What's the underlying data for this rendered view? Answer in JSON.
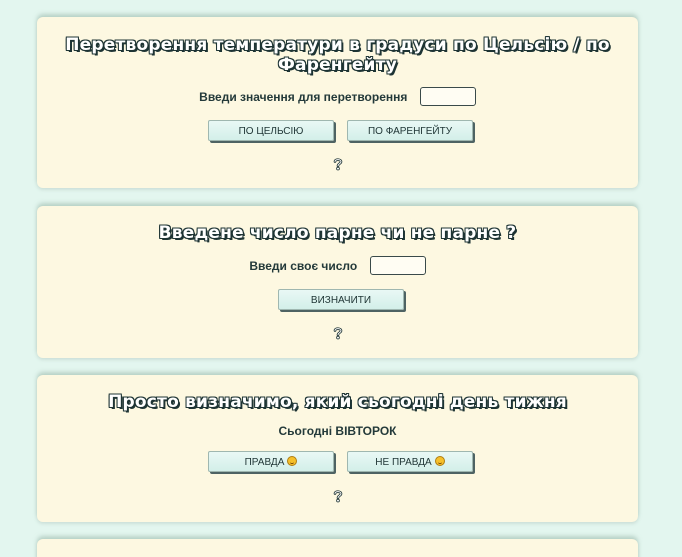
{
  "temperature": {
    "title_line1": "Перетворення температури в градуси по Цельсію / по",
    "title_line2": "Фаренгейту",
    "input_label": "Введи значення для перетворення",
    "input_value": "",
    "btn_celsius": "ПО ЦЕЛЬСІЮ",
    "btn_fahrenheit": "ПО ФАРЕНГЕЙТУ",
    "help_icon": "question-icon"
  },
  "parity": {
    "title": "Введене число парне чи не парне ?",
    "input_label": "Введи своє число",
    "input_value": "",
    "btn_determine": "ВИЗНАЧИТИ",
    "help_icon": "question-icon"
  },
  "weekday": {
    "title": "Просто визначимо, який сьогодні день тижня",
    "today_text": "Сьогодні ВІВТОРОК",
    "btn_true": "ПРАВДА",
    "btn_false": "НЕ ПРАВДА",
    "emoji_icon": "smiling-face-icon",
    "help_icon": "question-icon"
  },
  "colors": {
    "page_bg": "#e3f6ef",
    "card_bg": "#fdf8e1",
    "text": "#243a3a",
    "button_bg": "#dff4f0"
  }
}
